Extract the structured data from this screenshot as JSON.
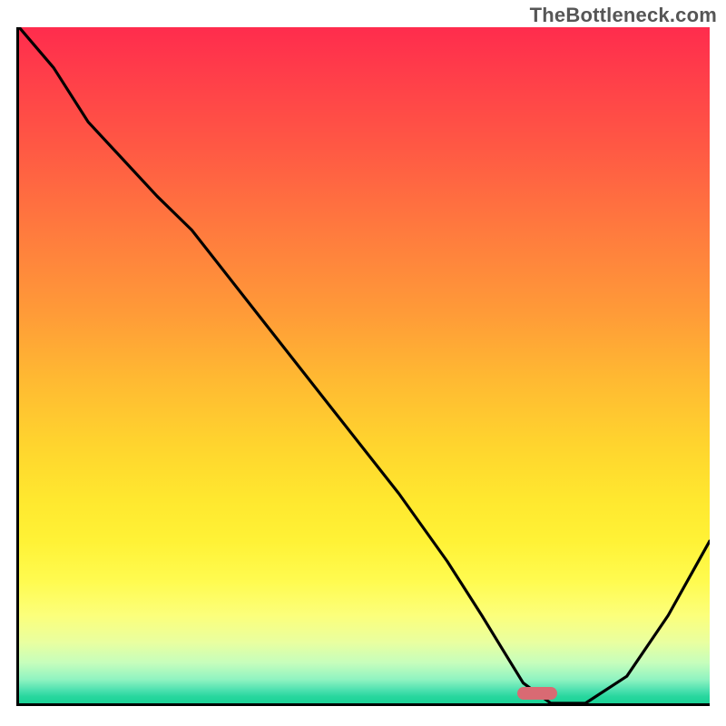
{
  "watermark": "TheBottleneck.com",
  "chart_data": {
    "type": "line",
    "title": "",
    "xlabel": "",
    "ylabel": "",
    "xlim": [
      0,
      100
    ],
    "ylim": [
      0,
      100
    ],
    "x": [
      0,
      5,
      10,
      20,
      25,
      35,
      45,
      55,
      62,
      67,
      70,
      73,
      77,
      82,
      88,
      94,
      100
    ],
    "values": [
      100,
      94,
      86,
      75,
      70,
      57,
      44,
      31,
      21,
      13,
      8,
      3,
      0,
      0,
      4,
      13,
      24
    ],
    "marker": {
      "x": 75,
      "y": 1.5,
      "width_pct": 5.8
    },
    "colors": {
      "top": "#ff2c4d",
      "bottom": "#1bd296",
      "curve": "#000000",
      "marker": "#d96a73",
      "axis": "#000000"
    }
  }
}
